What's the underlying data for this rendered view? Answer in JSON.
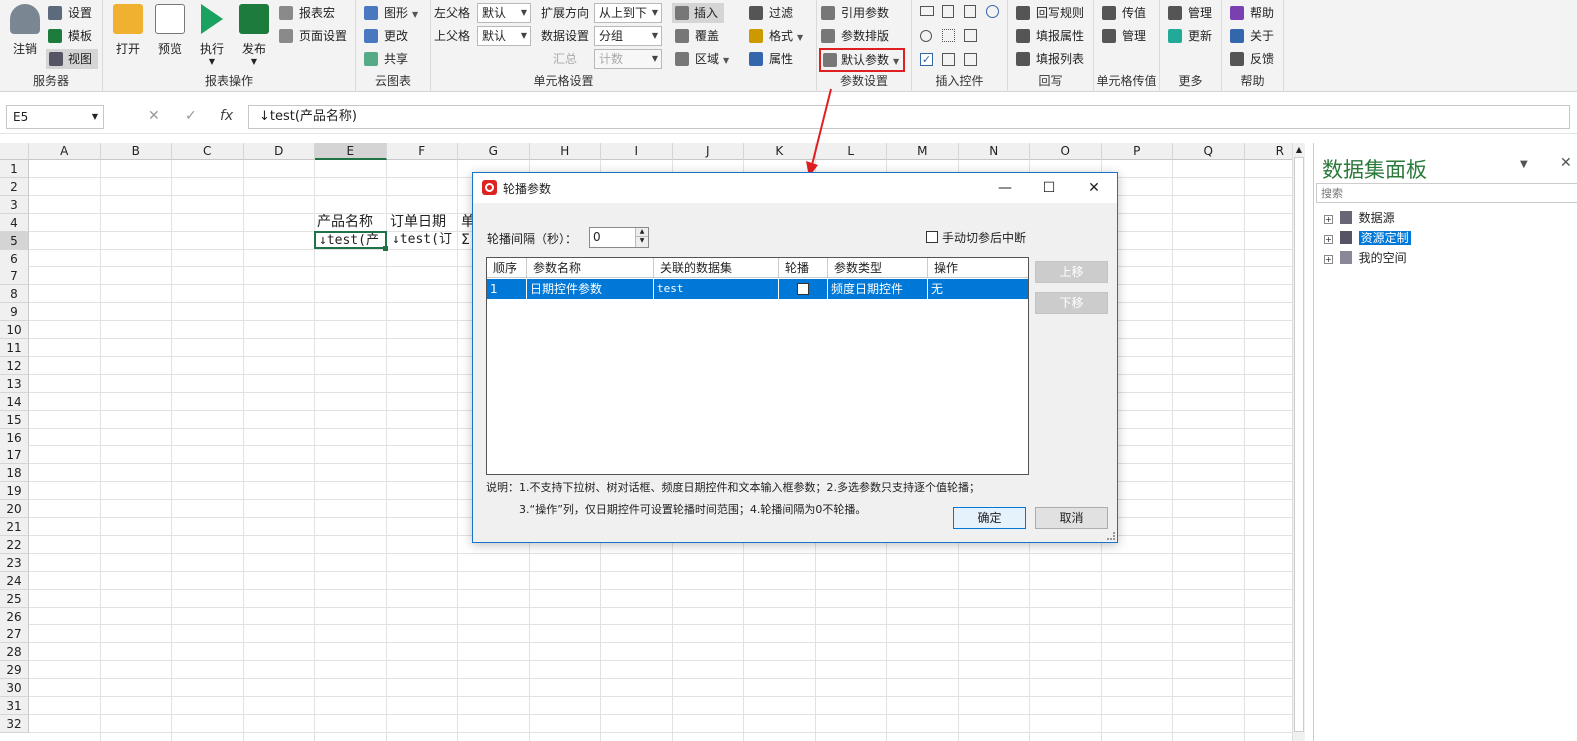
{
  "ribbon": {
    "server": {
      "logout": "注销",
      "settings": "设置",
      "template": "模板",
      "view": "视图",
      "label": "服务器"
    },
    "report_ops": {
      "open": "打开",
      "preview": "预览",
      "execute": "执行",
      "publish": "发布",
      "macro": "报表宏",
      "page_setup": "页面设置",
      "label": "报表操作"
    },
    "cloud": {
      "shape": "图形",
      "change": "更改",
      "share": "共享",
      "label": "云图表"
    },
    "cell_settings": {
      "left_parent": "左父格",
      "left_parent_val": "默认",
      "top_parent": "上父格",
      "top_parent_val": "默认",
      "expand_dir": "扩展方向",
      "expand_dir_val": "从上到下",
      "data_setting": "数据设置",
      "data_setting_val": "分组",
      "summary": "汇总",
      "summary_val": "计数",
      "insert": "插入",
      "cover": "覆盖",
      "region": "区域",
      "label": "单元格设置"
    },
    "filter": {
      "filter": "过滤",
      "format": "格式",
      "property": "属性"
    },
    "param": {
      "ref_param": "引用参数",
      "param_layout": "参数排版",
      "default_param": "默认参数",
      "label": "参数设置"
    },
    "insert_ctrl": {
      "label": "插入控件"
    },
    "writeback": {
      "rule": "回写规则",
      "fill_prop": "填报属性",
      "fill_list": "填报列表",
      "label": "回写"
    },
    "cell_pass": {
      "pass_value": "传值",
      "manage": "管理",
      "label": "单元格传值"
    },
    "more": {
      "manage": "管理",
      "update": "更新",
      "label": "更多"
    },
    "help": {
      "help": "帮助",
      "about": "关于",
      "feedback": "反馈",
      "label": "帮助"
    }
  },
  "formula_bar": {
    "cell_ref": "E5",
    "formula": "↓test(产品名称)",
    "cancel": "✕",
    "confirm": "✓",
    "fx": "fx"
  },
  "sheet": {
    "columns": [
      "A",
      "B",
      "C",
      "D",
      "E",
      "F",
      "G",
      "H",
      "I",
      "J",
      "K",
      "L",
      "M",
      "N",
      "O",
      "P",
      "Q",
      "R"
    ],
    "rows": [
      "1",
      "2",
      "3",
      "4",
      "5",
      "6",
      "7",
      "8",
      "9",
      "10",
      "11",
      "12",
      "13",
      "14",
      "15",
      "16",
      "17",
      "18",
      "19",
      "20",
      "21",
      "22",
      "23",
      "24",
      "25",
      "26",
      "27",
      "28",
      "29",
      "30",
      "31",
      "32"
    ],
    "e4": "产品名称",
    "f4": "订单日期",
    "g4": "单",
    "e5": "↓test(产",
    "f5": "↓test(订",
    "g5": "Σ"
  },
  "panel": {
    "title": "数据集面板",
    "search_placeholder": "搜索",
    "tree": [
      {
        "label": "数据源"
      },
      {
        "label": "资源定制"
      },
      {
        "label": "我的空间"
      }
    ]
  },
  "dialog": {
    "title": "轮播参数",
    "interval_label": "轮播间隔（秒）：",
    "interval_value": "0",
    "manual_interrupt": "手动切参后中断",
    "headers": [
      "顺序",
      "参数名称",
      "关联的数据集",
      "轮播",
      "参数类型",
      "操作"
    ],
    "rows": [
      {
        "order": "1",
        "name": "日期控件参数",
        "dataset": "test",
        "carousel": false,
        "type": "频度日期控件",
        "op": "无"
      }
    ],
    "move_up": "上移",
    "move_down": "下移",
    "note_line1": "说明：1.不支持下拉树、树对话框、频度日期控件和文本输入框参数；2.多选参数只支持逐个值轮播；",
    "note_line2": "3.“操作”列，仅日期控件可设置轮播时间范围；4.轮播间隔为0不轮播。",
    "ok": "确定",
    "cancel": "取消"
  }
}
